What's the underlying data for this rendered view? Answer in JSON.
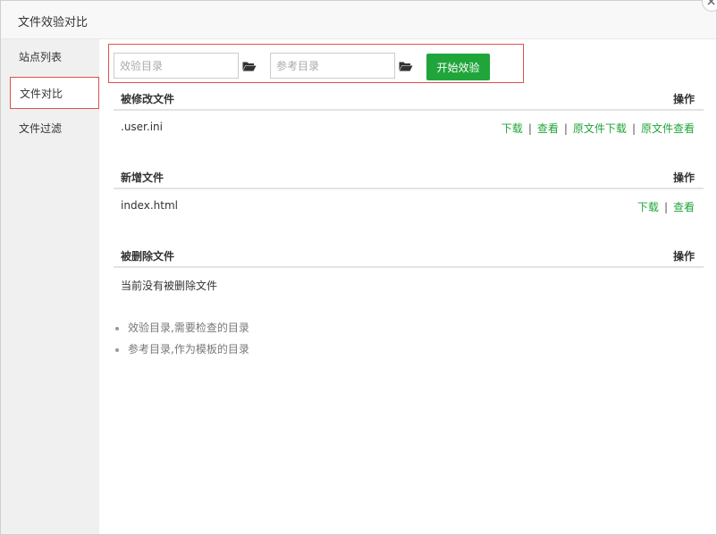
{
  "window": {
    "title": "文件效验对比"
  },
  "sidebar": {
    "items": [
      {
        "label": "站点列表",
        "active": false
      },
      {
        "label": "文件对比",
        "active": true
      },
      {
        "label": "文件过滤",
        "active": false
      }
    ]
  },
  "toolbar": {
    "check_dir_placeholder": "效验目录",
    "ref_dir_placeholder": "参考目录",
    "check_dir_value": "",
    "ref_dir_value": "",
    "start_label": "开始效验"
  },
  "sections": {
    "modified": {
      "title": "被修改文件",
      "op_header": "操作",
      "rows": [
        {
          "name": ".user.ini",
          "ops": [
            "下载",
            "查看",
            "原文件下载",
            "原文件查看"
          ]
        }
      ]
    },
    "added": {
      "title": "新增文件",
      "op_header": "操作",
      "rows": [
        {
          "name": "index.html",
          "ops": [
            "下载",
            "查看"
          ]
        }
      ]
    },
    "deleted": {
      "title": "被删除文件",
      "op_header": "操作",
      "empty_text": "当前没有被删除文件"
    }
  },
  "tips": [
    "效验目录,需要检查的目录",
    "参考目录,作为模板的目录"
  ],
  "colors": {
    "accent": "#20a53a",
    "highlight_border": "#d9534f",
    "sidebar_bg": "#f0f0f0"
  },
  "icons": {
    "folder": "folder-open-icon",
    "close": "close-icon"
  }
}
